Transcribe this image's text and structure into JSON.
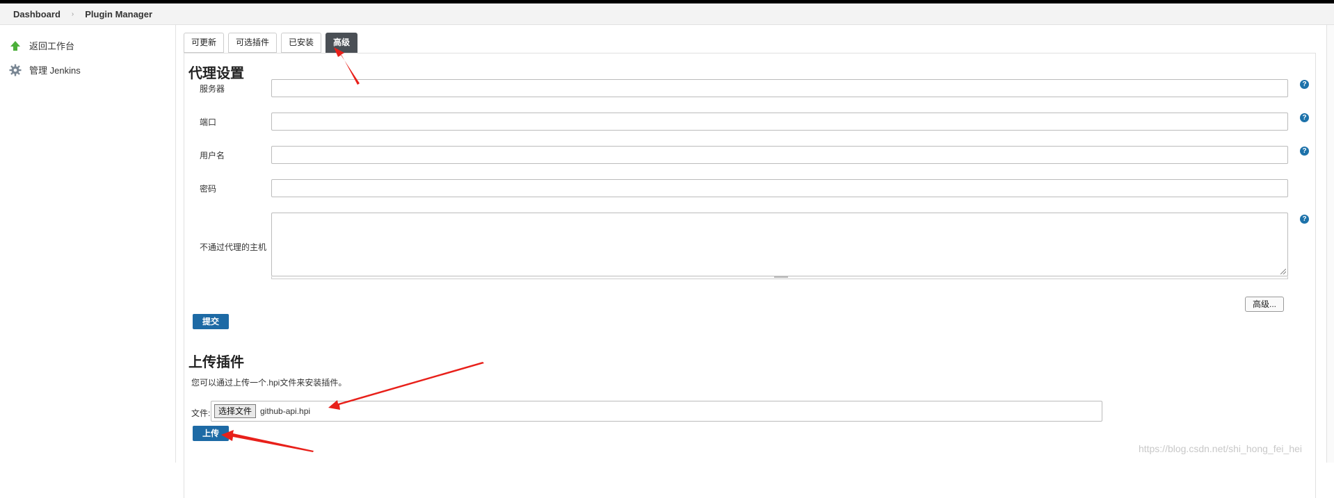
{
  "breadcrumb": {
    "items": [
      "Dashboard",
      "Plugin Manager"
    ]
  },
  "sidebar": {
    "items": [
      {
        "label": "返回工作台",
        "icon": "up-arrow-icon"
      },
      {
        "label": "管理 Jenkins",
        "icon": "gear-icon"
      }
    ]
  },
  "tabs": [
    {
      "label": "可更新"
    },
    {
      "label": "可选插件"
    },
    {
      "label": "已安装"
    },
    {
      "label": "高级",
      "active": true
    }
  ],
  "proxy": {
    "title": "代理设置",
    "fields": [
      {
        "label": "服务器",
        "value": ""
      },
      {
        "label": "端口",
        "value": ""
      },
      {
        "label": "用户名",
        "value": ""
      },
      {
        "label": "密码",
        "value": ""
      },
      {
        "label": "不通过代理的主机",
        "value": ""
      }
    ],
    "advanced_button": "高级...",
    "submit_button": "提交"
  },
  "upload": {
    "title": "上传插件",
    "description": "您可以通过上传一个.hpi文件来安装插件。",
    "file_label": "文件:",
    "choose_button": "选择文件",
    "file_name": "github-api.hpi",
    "upload_button": "上传"
  },
  "watermark": "https://blog.csdn.net/shi_hong_fei_hei",
  "colors": {
    "primary": "#1d6aa5",
    "active_tab": "#4a4f55",
    "annotation_arrow": "#e8201a",
    "help_icon": "#1d72aa"
  }
}
